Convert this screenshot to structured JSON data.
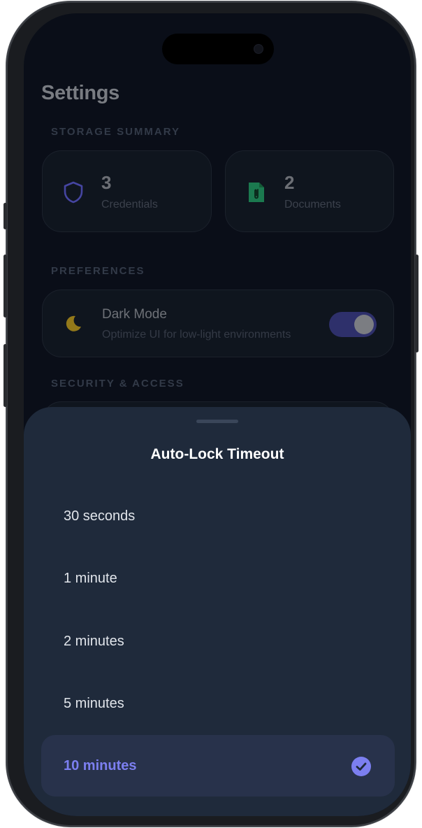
{
  "settings": {
    "title": "Settings",
    "sections": {
      "storage": "STORAGE SUMMARY",
      "preferences": "PREFERENCES",
      "security": "SECURITY & ACCESS"
    },
    "stats": [
      {
        "value": "3",
        "label": "Credentials",
        "icon": "shield-icon",
        "color": "#4f4fb8"
      },
      {
        "value": "2",
        "label": "Documents",
        "icon": "document-clip-icon",
        "color": "#1f8a5a"
      }
    ],
    "dark_mode": {
      "title": "Dark Mode",
      "subtitle": "Optimize UI for low-light environments",
      "icon": "moon-icon",
      "enabled": true
    }
  },
  "sheet": {
    "title": "Auto-Lock Timeout",
    "options": [
      {
        "label": "30 seconds",
        "selected": false
      },
      {
        "label": "1 minute",
        "selected": false
      },
      {
        "label": "2 minutes",
        "selected": false
      },
      {
        "label": "5 minutes",
        "selected": false
      },
      {
        "label": "10 minutes",
        "selected": true
      }
    ]
  },
  "colors": {
    "accent": "#7c7ff0",
    "sheet_bg": "#1f2a3b",
    "screen_bg": "#0c111c"
  }
}
